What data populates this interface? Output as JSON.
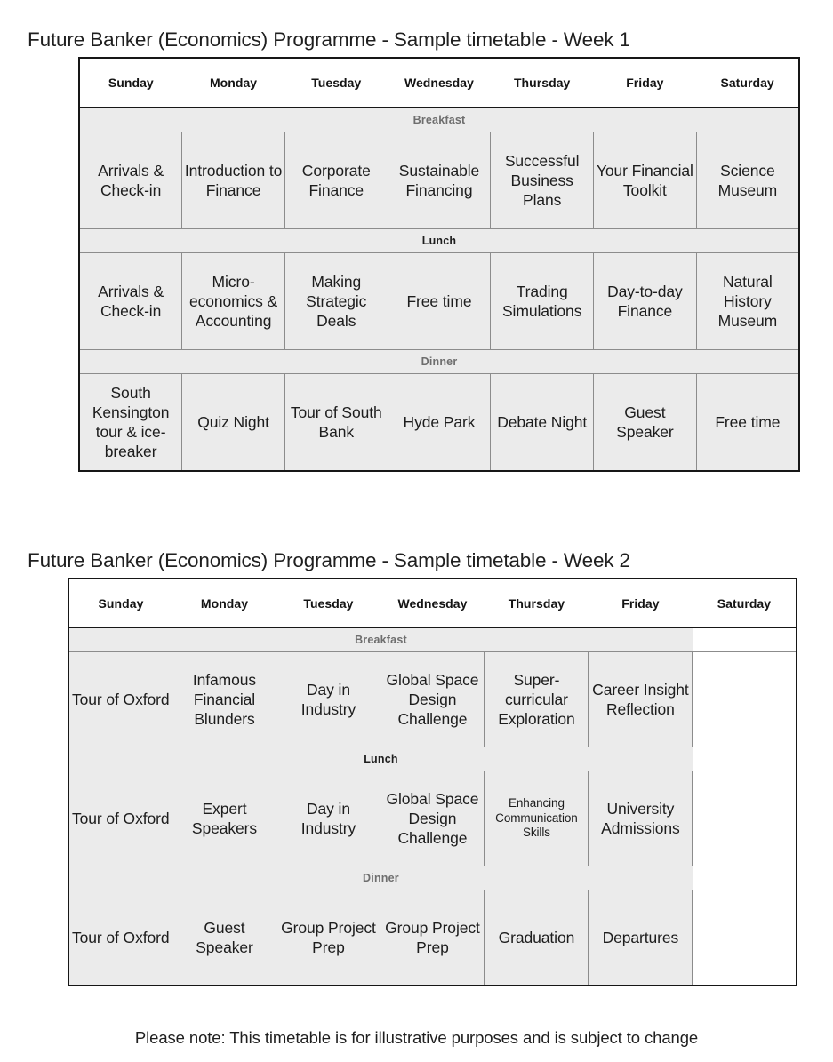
{
  "document": {
    "footnote": "Please note: This timetable is for illustrative purposes and is subject to change"
  },
  "weeks": [
    {
      "title": "Future Banker (Economics) Programme - Sample timetable - Week 1",
      "columns": [
        "Sunday",
        "Monday",
        "Tuesday",
        "Wednesday",
        "Thursday",
        "Friday",
        "Saturday"
      ],
      "sessions": [
        {
          "meal": "Breakfast",
          "meal_style": "grey",
          "cells": [
            "Arrivals & Check-in",
            "Introduction to Finance",
            "Corporate Finance",
            "Sustainable Financing",
            "Successful Business Plans",
            "Your Financial Toolkit",
            "Science Museum"
          ]
        },
        {
          "meal": "Lunch",
          "meal_style": "dark",
          "cells": [
            "Arrivals & Check-in",
            "Micro-economics & Accounting",
            "Making Strategic Deals",
            "Free time",
            "Trading Simulations",
            "Day-to-day Finance",
            "Natural History Museum"
          ]
        },
        {
          "meal": "Dinner",
          "meal_style": "grey",
          "cells": [
            "South Kensington tour & ice-breaker",
            "Quiz Night",
            "Tour of South Bank",
            "Hyde Park",
            "Debate Night",
            "Guest Speaker",
            "Free time"
          ]
        }
      ]
    },
    {
      "title": "Future Banker (Economics) Programme - Sample timetable - Week 2",
      "columns": [
        "Sunday",
        "Monday",
        "Tuesday",
        "Wednesday",
        "Thursday",
        "Friday",
        "Saturday"
      ],
      "sessions": [
        {
          "meal": "Breakfast",
          "meal_style": "grey",
          "cells": [
            "Tour of Oxford",
            "Infamous Financial Blunders",
            "Day in Industry",
            "Global Space Design Challenge",
            "Super-curricular Exploration",
            "Career Insight Reflection",
            ""
          ]
        },
        {
          "meal": "Lunch",
          "meal_style": "dark",
          "cells": [
            "Tour of Oxford",
            "Expert Speakers",
            "Day in Industry",
            "Global Space Design Challenge",
            "Enhancing Communication Skills",
            "University Admissions",
            ""
          ]
        },
        {
          "meal": "Dinner",
          "meal_style": "grey",
          "cells": [
            "Tour of Oxford",
            "Guest Speaker",
            "Group Project Prep",
            "Group Project Prep",
            "Graduation",
            "Departures",
            ""
          ]
        }
      ]
    }
  ],
  "colors": {
    "cell_background": "#ebebeb",
    "empty_cell_background": "#ffffff",
    "outer_border": "#161616",
    "inner_border": "#8c8c8c",
    "meal_label_grey": "#6e6e6e",
    "meal_label_dark": "#1d1d1d",
    "text": "#1d1d1d"
  }
}
